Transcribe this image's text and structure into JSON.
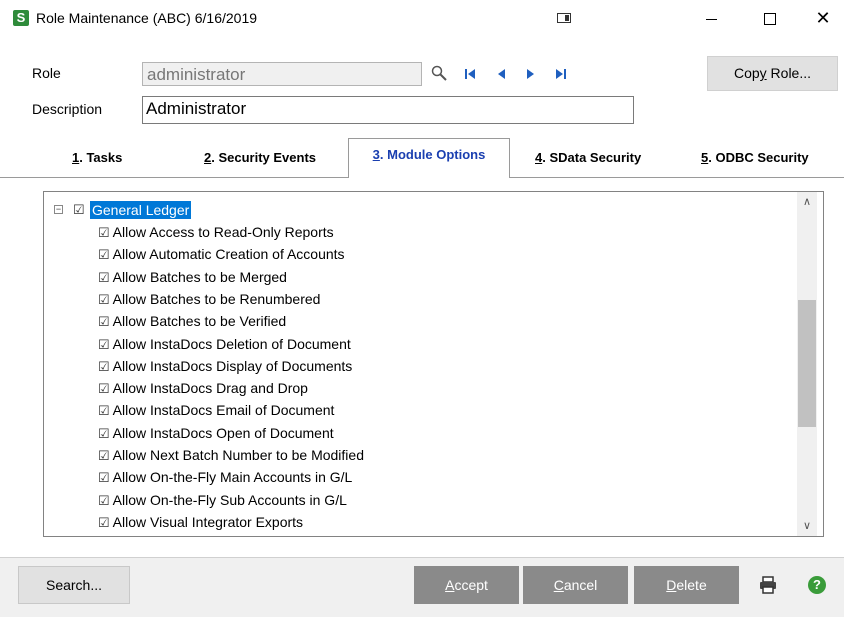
{
  "window": {
    "icon_letter": "S",
    "title": "Role Maintenance (ABC) 6/16/2019",
    "close_glyph": "✕"
  },
  "form": {
    "role_label": "Role",
    "role_value": "administrator",
    "description_label": "Description",
    "description_value": "Administrator",
    "copy_role_label_pre": "Cop",
    "copy_role_label_accel": "y",
    "copy_role_label_post": " Role..."
  },
  "tabs": [
    {
      "num": "1",
      "label": ". Tasks"
    },
    {
      "num": "2",
      "label": ". Security Events"
    },
    {
      "num": "3",
      "label": ". Module Options"
    },
    {
      "num": "4",
      "label": ". SData Security"
    },
    {
      "num": "5",
      "label": ". ODBC Security"
    }
  ],
  "tree": {
    "root_label": "General Ledger",
    "check_glyph": "☑",
    "expander_glyph": "−",
    "items": [
      "Allow Access to Read-Only Reports",
      "Allow Automatic Creation of Accounts",
      "Allow Batches to be Merged",
      "Allow Batches to be Renumbered",
      "Allow Batches to be Verified",
      "Allow InstaDocs Deletion of Document",
      "Allow InstaDocs Display of Documents",
      "Allow InstaDocs Drag and Drop",
      "Allow InstaDocs Email of Document",
      "Allow InstaDocs Open of Document",
      "Allow Next Batch Number to be Modified",
      "Allow On-the-Fly Main Accounts in G/L",
      "Allow On-the-Fly Sub Accounts in G/L",
      "Allow Visual Integrator Exports"
    ]
  },
  "scrollbar": {
    "up_glyph": "∧",
    "down_glyph": "∨"
  },
  "buttons": {
    "search_label": "Search...",
    "accept_accel": "A",
    "accept_rest": "ccept",
    "cancel_accel": "C",
    "cancel_rest": "ancel",
    "delete_accel": "D",
    "delete_rest": "elete",
    "help_glyph": "?"
  },
  "colors": {
    "selection": "#0078d7",
    "active_tab_text": "#1a3fb0",
    "disabled_button": "#8a8a8a",
    "app_icon": "#2e8b3a"
  }
}
